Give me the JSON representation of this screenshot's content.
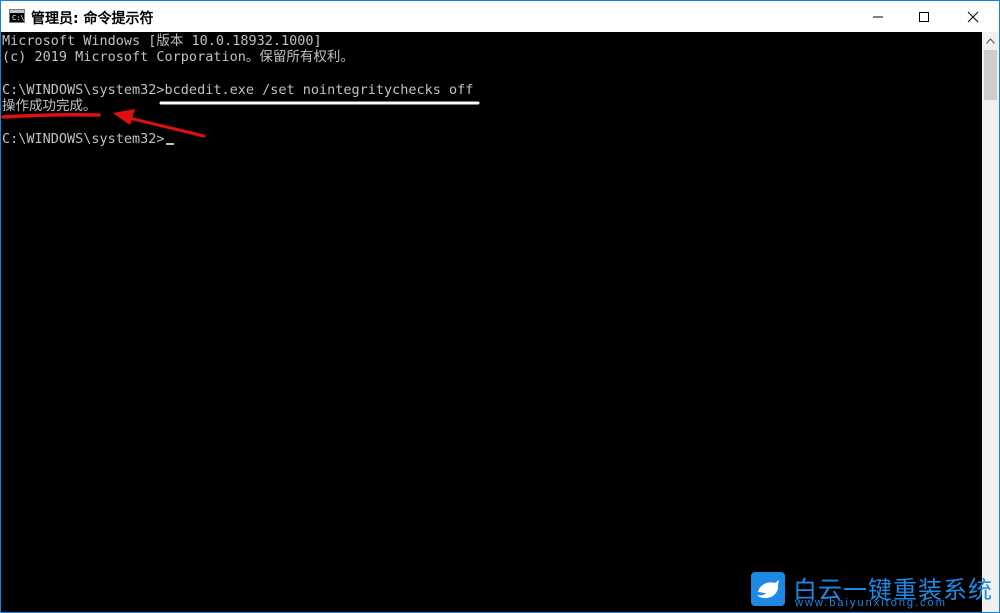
{
  "window": {
    "title": "管理员: 命令提示符",
    "icon": "cmd-icon",
    "icon_text": "C:\\_",
    "border_color": "#1883d7",
    "controls": {
      "minimize_icon": "minimize-icon",
      "maximize_icon": "maximize-icon",
      "close_icon": "close-icon"
    }
  },
  "console": {
    "text_color": "#c0c0c0",
    "background": "#000000",
    "lines": [
      "Microsoft Windows [版本 10.0.18932.1000]",
      "(c) 2019 Microsoft Corporation。保留所有权利。",
      "",
      "C:\\WINDOWS\\system32>bcdedit.exe /set nointegritychecks off",
      "操作成功完成。",
      "",
      "C:\\WINDOWS\\system32>"
    ]
  },
  "scrollbar": {
    "up_icon": "chevron-up-icon"
  },
  "annotations": {
    "command_underline_color": "#ffffff",
    "result_underline_color": "#e01010",
    "arrow_color": "#e01010",
    "arrow_icon": "red-arrow-icon"
  },
  "watermark": {
    "logo_icon": "bird-logo-icon",
    "name": "白云一键重装系统",
    "url": "www.baiyunxitong.com",
    "color": "#1e88e5"
  }
}
